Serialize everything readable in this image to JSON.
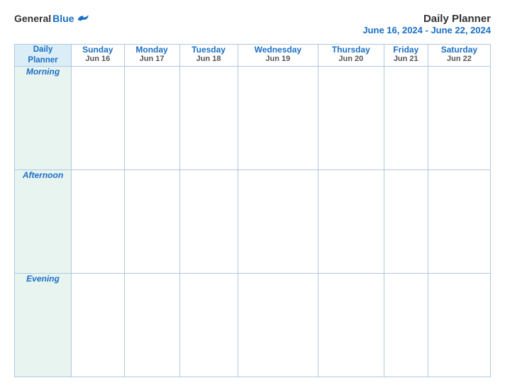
{
  "header": {
    "logo": {
      "general": "General",
      "blue": "Blue"
    },
    "title": "Daily Planner",
    "date_range": "June 16, 2024 - June 22, 2024"
  },
  "columns": [
    {
      "id": "daily-planner",
      "name": "Daily",
      "sub": "Planner",
      "date": ""
    },
    {
      "id": "sunday",
      "name": "Sunday",
      "sub": "",
      "date": "Jun 16"
    },
    {
      "id": "monday",
      "name": "Monday",
      "sub": "",
      "date": "Jun 17"
    },
    {
      "id": "tuesday",
      "name": "Tuesday",
      "sub": "",
      "date": "Jun 18"
    },
    {
      "id": "wednesday",
      "name": "Wednesday",
      "sub": "",
      "date": "Jun 19"
    },
    {
      "id": "thursday",
      "name": "Thursday",
      "sub": "",
      "date": "Jun 20"
    },
    {
      "id": "friday",
      "name": "Friday",
      "sub": "",
      "date": "Jun 21"
    },
    {
      "id": "saturday",
      "name": "Saturday",
      "sub": "",
      "date": "Jun 22"
    }
  ],
  "rows": [
    {
      "id": "morning",
      "label": "Morning"
    },
    {
      "id": "afternoon",
      "label": "Afternoon"
    },
    {
      "id": "evening",
      "label": "Evening"
    }
  ]
}
